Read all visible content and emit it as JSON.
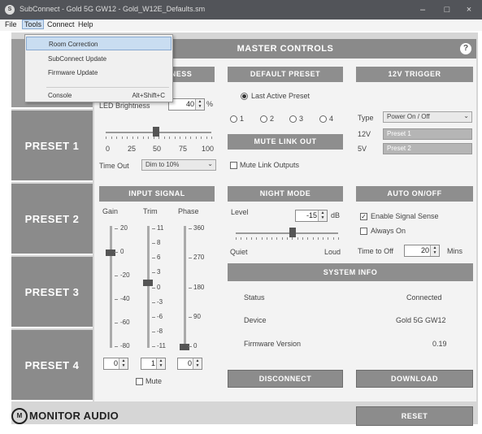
{
  "window": {
    "title": "SubConnect - Gold 5G GW12 - Gold_W12E_Defaults.sm",
    "minimize": "–",
    "maximize": "□",
    "close": "×"
  },
  "menubar": [
    "File",
    "Tools",
    "Connect",
    "Help"
  ],
  "tools_menu": {
    "items": [
      {
        "label": "Room Correction",
        "shortcut": ""
      },
      {
        "label": "SubConnect Update",
        "shortcut": ""
      },
      {
        "label": "Firmware Update",
        "shortcut": ""
      },
      {
        "label": "Console",
        "shortcut": "Alt+Shift+C"
      }
    ]
  },
  "colors": {
    "accent_tab": "#9a9a9a",
    "preset_tab": "#8b8b8b",
    "section_header": "#8e8e8e"
  },
  "sidebar": {
    "presets": [
      "PRESET 1",
      "PRESET 2",
      "PRESET 3",
      "PRESET 4"
    ]
  },
  "master": {
    "title": "MASTER CONTROLS",
    "help": "?"
  },
  "led": {
    "header": "LED BRIGHTNESS",
    "label": "LED Brightness",
    "value": "40",
    "unit": "%",
    "slider_level": 0.4,
    "ticks": [
      "0",
      "25",
      "50",
      "75",
      "100"
    ],
    "timeout_label": "Time Out",
    "timeout_value": "Dim to 10%"
  },
  "default_preset": {
    "header": "DEFAULT PRESET",
    "last_active": "Last Active Preset",
    "options": [
      "1",
      "2",
      "3",
      "4"
    ]
  },
  "mute_link": {
    "header": "MUTE LINK OUT",
    "checkbox": "Mute Link Outputs"
  },
  "trigger": {
    "header": "12V TRIGGER",
    "type_label": "Type",
    "type_value": "Power On / Off",
    "v12_label": "12V",
    "v12_value": "Preset 1",
    "v5_label": "5V",
    "v5_value": "Preset 2"
  },
  "input_signal": {
    "header": "INPUT SIGNAL",
    "gain_label": "Gain",
    "trim_label": "Trim",
    "phase_label": "Phase",
    "gain_ticks": [
      "20",
      "0",
      "-20",
      "-40",
      "-60",
      "-80"
    ],
    "trim_ticks": [
      "11",
      "8",
      "6",
      "3",
      "0",
      "-3",
      "-6",
      "-8",
      "-11"
    ],
    "phase_ticks": [
      "360",
      "270",
      "180",
      "90",
      "0"
    ],
    "gain_value": "0",
    "trim_value": "1",
    "phase_value": "0",
    "mute": "Mute"
  },
  "night_mode": {
    "header": "NIGHT MODE",
    "level_label": "Level",
    "level_value": "-15",
    "unit": "dB",
    "quiet": "Quiet",
    "loud": "Loud"
  },
  "auto_onoff": {
    "header": "AUTO ON/OFF",
    "enable_sense": "Enable Signal Sense",
    "always_on": "Always On",
    "time_label": "Time to Off",
    "time_value": "20",
    "unit": "Mins"
  },
  "system_info": {
    "header": "SYSTEM INFO",
    "rows": [
      {
        "label": "Status",
        "value": "Connected"
      },
      {
        "label": "Device",
        "value": "Gold 5G GW12"
      },
      {
        "label": "Firmware Version",
        "value": "0.19"
      }
    ]
  },
  "actions": {
    "disconnect": "DISCONNECT",
    "download": "DOWNLOAD",
    "reset": "RESET"
  },
  "logo": {
    "mark": "M",
    "text": "MONITOR AUDIO"
  }
}
